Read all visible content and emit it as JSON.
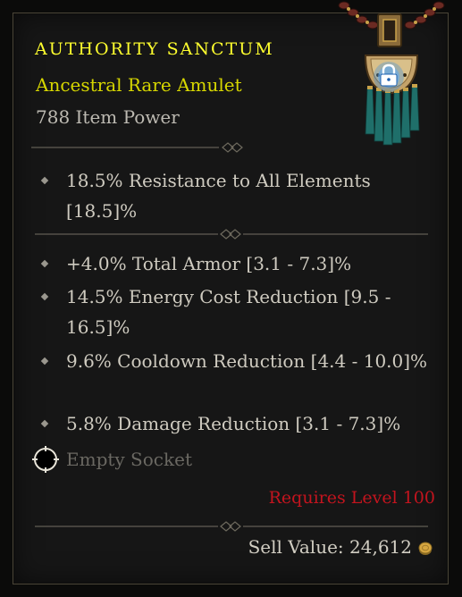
{
  "item": {
    "name": "AUTHORITY SANCTUM",
    "type": "Ancestral Rare Amulet",
    "power": "788 Item Power",
    "icon": "amulet-icon",
    "locked_icon": "lock-icon"
  },
  "stats_primary": [
    {
      "text": "18.5% Resistance to All Elements [18.5]%"
    }
  ],
  "stats_affixes": [
    {
      "text": "+4.0% Total Armor [3.1 - 7.3]%"
    },
    {
      "text": "14.5% Energy Cost Reduction [9.5 - 16.5]%"
    },
    {
      "text": "9.6% Cooldown Reduction [4.4 - 10.0]%"
    },
    {
      "text": "5.8% Damage Reduction [3.1 - 7.3]%"
    }
  ],
  "socket": {
    "label": "Empty Socket"
  },
  "requirement": "Requires Level 100",
  "sell": {
    "label": "Sell Value:",
    "value": "24,612",
    "icon": "gold-coin-icon"
  },
  "colors": {
    "name": "#ffff2e",
    "type": "#d6d600",
    "requirement": "#c3141e",
    "stat_text": "#cfcbc0"
  }
}
